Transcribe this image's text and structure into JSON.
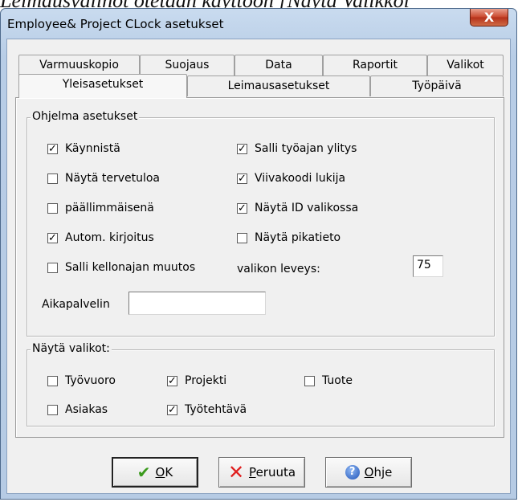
{
  "background_text": "Leimausvalinot otetaan käyttöön [Näytä Valikkoi",
  "window": {
    "title": "Employee& Project CLock asetukset",
    "close_symbol": "X"
  },
  "tabs_row1": [
    {
      "label": "Varmuuskopio"
    },
    {
      "label": "Suojaus"
    },
    {
      "label": "Data"
    },
    {
      "label": "Raportit"
    },
    {
      "label": "Valikot"
    }
  ],
  "tabs_row2": [
    {
      "label": "Yleisasetukset",
      "active": true
    },
    {
      "label": "Leimausasetukset"
    },
    {
      "label": "Työpäivä"
    }
  ],
  "program_settings": {
    "legend": "Ohjelma asetukset",
    "checkboxes": [
      {
        "label": "Käynnistä",
        "checked": true
      },
      {
        "label": "Näytä tervetuloa",
        "checked": false
      },
      {
        "label": "päällimmäisenä",
        "checked": false
      },
      {
        "label": "Autom. kirjoitus",
        "checked": true
      },
      {
        "label": "Salli kellonajan muutos",
        "checked": false
      },
      {
        "label": "Salli työajan ylitys",
        "checked": true
      },
      {
        "label": "Viivakoodi lukija",
        "checked": true
      },
      {
        "label": "Näytä ID valikossa",
        "checked": true
      },
      {
        "label": "Näytä pikatieto",
        "checked": false
      }
    ],
    "menu_width_label": "valikon leveys:",
    "menu_width_value": "75",
    "time_server_label": "Aikapalvelin",
    "time_server_value": ""
  },
  "show_menus": {
    "legend": "Näytä valikot:",
    "checkboxes": [
      {
        "label": "Työvuoro",
        "checked": false
      },
      {
        "label": "Projekti",
        "checked": true
      },
      {
        "label": "Tuote",
        "checked": false
      },
      {
        "label": "Asiakas",
        "checked": false
      },
      {
        "label": "Työtehtävä",
        "checked": true
      }
    ]
  },
  "buttons": {
    "ok": {
      "mnemonic": "O",
      "rest": "K",
      "icon": "checkmark-icon"
    },
    "cancel": {
      "mnemonic": "P",
      "rest": "eruuta",
      "icon": "x-icon"
    },
    "help": {
      "mnemonic": "O",
      "rest": "hje",
      "icon": "help-icon"
    }
  },
  "colors": {
    "titlebar": "#b9cde6",
    "close_button": "#c9462c",
    "checkmark": "#3a9a1c",
    "cancel_x": "#e02020",
    "help_icon": "#1f53b8"
  }
}
